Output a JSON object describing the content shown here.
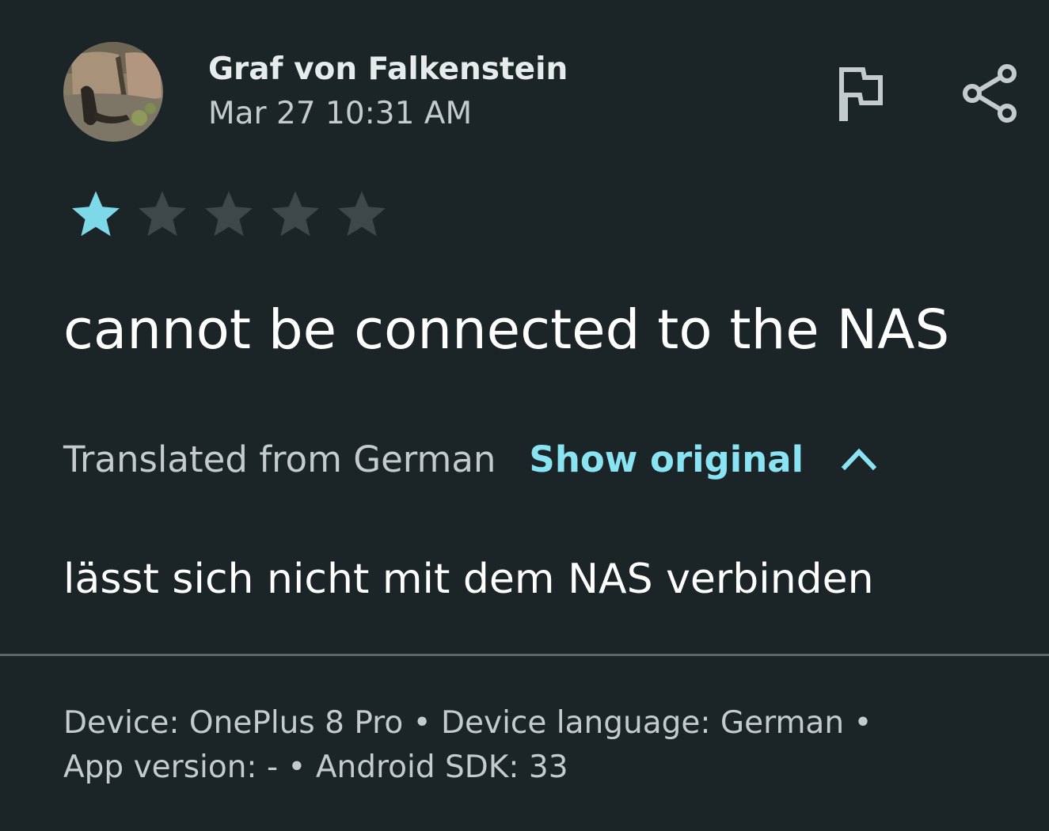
{
  "review": {
    "author": "Graf von Falkenstein",
    "date": "Mar 27 10:31 AM",
    "rating": 1,
    "max_rating": 5,
    "text": "cannot be connected to the NAS",
    "translation_note": "Translated from German",
    "show_original_label": "Show original",
    "original_text": "lässt sich nicht mit dem NAS verbinden"
  },
  "icons": {
    "report": "flag-icon",
    "share": "share-icon",
    "collapse": "chevron-up-icon",
    "star": "star-icon"
  },
  "device_info": {
    "line1": "Device: OnePlus 8 Pro • Device language: German •",
    "line2": "App version: - • Android SDK: 33"
  },
  "colors": {
    "background": "#1b2427",
    "accent": "#8ae3f2",
    "star_filled": "#7dd9e8",
    "star_empty": "#3e4749",
    "divider": "#5d6769"
  }
}
